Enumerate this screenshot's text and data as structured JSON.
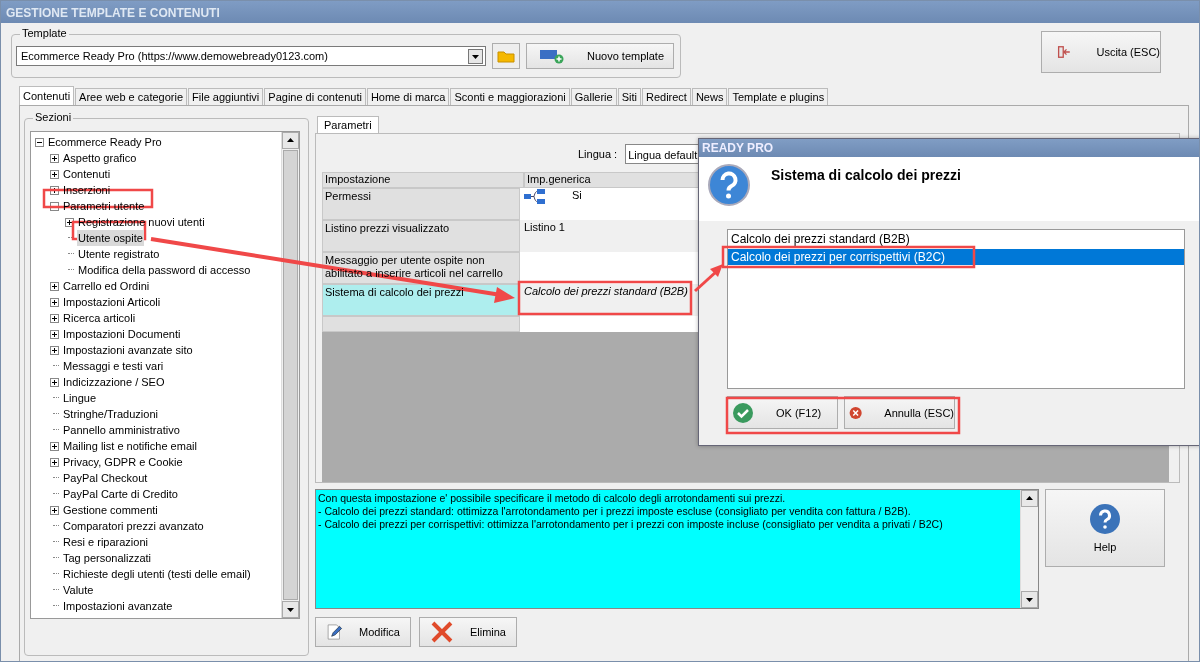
{
  "window": {
    "title": "GESTIONE TEMPLATE E CONTENUTI"
  },
  "template": {
    "label": "Template",
    "value": "Ecommerce Ready Pro (https://www.demowebready0123.com)",
    "new_button": "Nuovo template"
  },
  "exit_button": "Uscita (ESC)",
  "tabs": [
    {
      "label": "Contenuti",
      "selected": true
    },
    {
      "label": "Aree web e categorie",
      "selected": false
    },
    {
      "label": "File aggiuntivi",
      "selected": false
    },
    {
      "label": "Pagine di contenuti",
      "selected": false
    },
    {
      "label": "Home di marca",
      "selected": false
    },
    {
      "label": "Sconti e maggiorazioni",
      "selected": false
    },
    {
      "label": "Gallerie",
      "selected": false
    },
    {
      "label": "Siti",
      "selected": false
    },
    {
      "label": "Redirect",
      "selected": false
    },
    {
      "label": "News",
      "selected": false
    },
    {
      "label": "Template e plugins",
      "selected": false
    }
  ],
  "sections": {
    "label": "Sezioni",
    "tree": [
      {
        "label": "Ecommerce Ready Pro",
        "kind": "folder",
        "expanded": true,
        "selected": false,
        "children": [
          {
            "label": "Aspetto grafico",
            "kind": "folder",
            "expanded": false,
            "selected": false
          },
          {
            "label": "Contenuti",
            "kind": "folder",
            "expanded": false,
            "selected": false
          },
          {
            "label": "Inserzioni",
            "kind": "folder",
            "expanded": false,
            "selected": false
          },
          {
            "label": "Parametri utente",
            "kind": "folder",
            "expanded": true,
            "selected": false,
            "children": [
              {
                "label": "Registrazione nuovi utenti",
                "kind": "folder",
                "expanded": false,
                "selected": false
              },
              {
                "label": "Utente ospite",
                "kind": "leaf",
                "selected": true
              },
              {
                "label": "Utente registrato",
                "kind": "leaf",
                "selected": false
              },
              {
                "label": "Modifica della password di accesso",
                "kind": "leaf",
                "selected": false
              }
            ]
          },
          {
            "label": "Carrello ed Ordini",
            "kind": "folder",
            "expanded": false,
            "selected": false
          },
          {
            "label": "Impostazioni Articoli",
            "kind": "folder",
            "expanded": false,
            "selected": false
          },
          {
            "label": "Ricerca articoli",
            "kind": "folder",
            "expanded": false,
            "selected": false
          },
          {
            "label": "Impostazioni Documenti",
            "kind": "folder",
            "expanded": false,
            "selected": false
          },
          {
            "label": "Impostazioni avanzate sito",
            "kind": "folder",
            "expanded": false,
            "selected": false
          },
          {
            "label": "Messaggi e testi vari",
            "kind": "leaf",
            "selected": false
          },
          {
            "label": "Indicizzazione / SEO",
            "kind": "folder",
            "expanded": false,
            "selected": false
          },
          {
            "label": "Lingue",
            "kind": "leaf",
            "selected": false
          },
          {
            "label": "Stringhe/Traduzioni",
            "kind": "leaf",
            "selected": false
          },
          {
            "label": "Pannello amministrativo",
            "kind": "leaf",
            "selected": false
          },
          {
            "label": "Mailing list e notifiche email",
            "kind": "folder",
            "expanded": false,
            "selected": false
          },
          {
            "label": "Privacy, GDPR e Cookie",
            "kind": "folder",
            "expanded": false,
            "selected": false
          },
          {
            "label": "PayPal Checkout",
            "kind": "leaf",
            "selected": false
          },
          {
            "label": "PayPal Carte di Credito",
            "kind": "leaf",
            "selected": false
          },
          {
            "label": "Gestione commenti",
            "kind": "folder",
            "expanded": false,
            "selected": false
          },
          {
            "label": "Comparatori prezzi avanzato",
            "kind": "leaf",
            "selected": false
          },
          {
            "label": "Resi e riparazioni",
            "kind": "leaf",
            "selected": false
          },
          {
            "label": "Tag personalizzati",
            "kind": "leaf",
            "selected": false
          },
          {
            "label": "Richieste degli utenti (testi delle email)",
            "kind": "leaf",
            "selected": false
          },
          {
            "label": "Valute",
            "kind": "leaf",
            "selected": false
          },
          {
            "label": "Impostazioni avanzate",
            "kind": "leaf",
            "selected": false
          }
        ]
      }
    ]
  },
  "parameters": {
    "tab": "Parametri",
    "language_label": "Lingua :",
    "language_value": "Lingua default",
    "columns": [
      "Impostazione",
      "Imp.generica"
    ],
    "rows": [
      {
        "setting": "Permessi",
        "value": "Si",
        "kind": "permission",
        "selected": false
      },
      {
        "setting": "Listino prezzi visualizzato",
        "value": "Listino 1",
        "kind": "text",
        "selected": false
      },
      {
        "setting": "Messaggio per utente ospite non abilitato a inserire articoli nel carrello",
        "kind": "text",
        "selected": false
      },
      {
        "setting": "Sistema di calcolo dei prezzi",
        "value": "Calcolo dei prezzi standard (B2B)",
        "kind": "choice",
        "selected": true
      }
    ]
  },
  "description": [
    "Con questa impostazione e' possibile specificare il metodo di calcolo degli arrotondamenti sui prezzi.",
    "- Calcolo dei prezzi standard: ottimizza l'arrotondamento per i prezzi imposte escluse (consigliato per vendita con fattura / B2B).",
    "- Calcolo dei prezzi per corrispettivi: ottimizza l'arrotondamento per i prezzi con imposte incluse (consigliato per vendita a privati / B2C)"
  ],
  "help_button": "Help",
  "buttons": [
    {
      "label": "Modifica",
      "kind": "edit"
    },
    {
      "label": "Elimina",
      "kind": "delete"
    }
  ],
  "dialog": {
    "title": "READY PRO",
    "heading": "Sistema di calcolo dei prezzi",
    "options": [
      {
        "label": "Calcolo dei prezzi standard (B2B)",
        "selected": false
      },
      {
        "label": "Calcolo dei prezzi per corrispettivi (B2C)",
        "selected": true
      }
    ],
    "buttons": [
      {
        "label": "OK (F12)",
        "kind": "ok"
      },
      {
        "label": "Annulla (ESC)",
        "kind": "cancel"
      }
    ]
  }
}
